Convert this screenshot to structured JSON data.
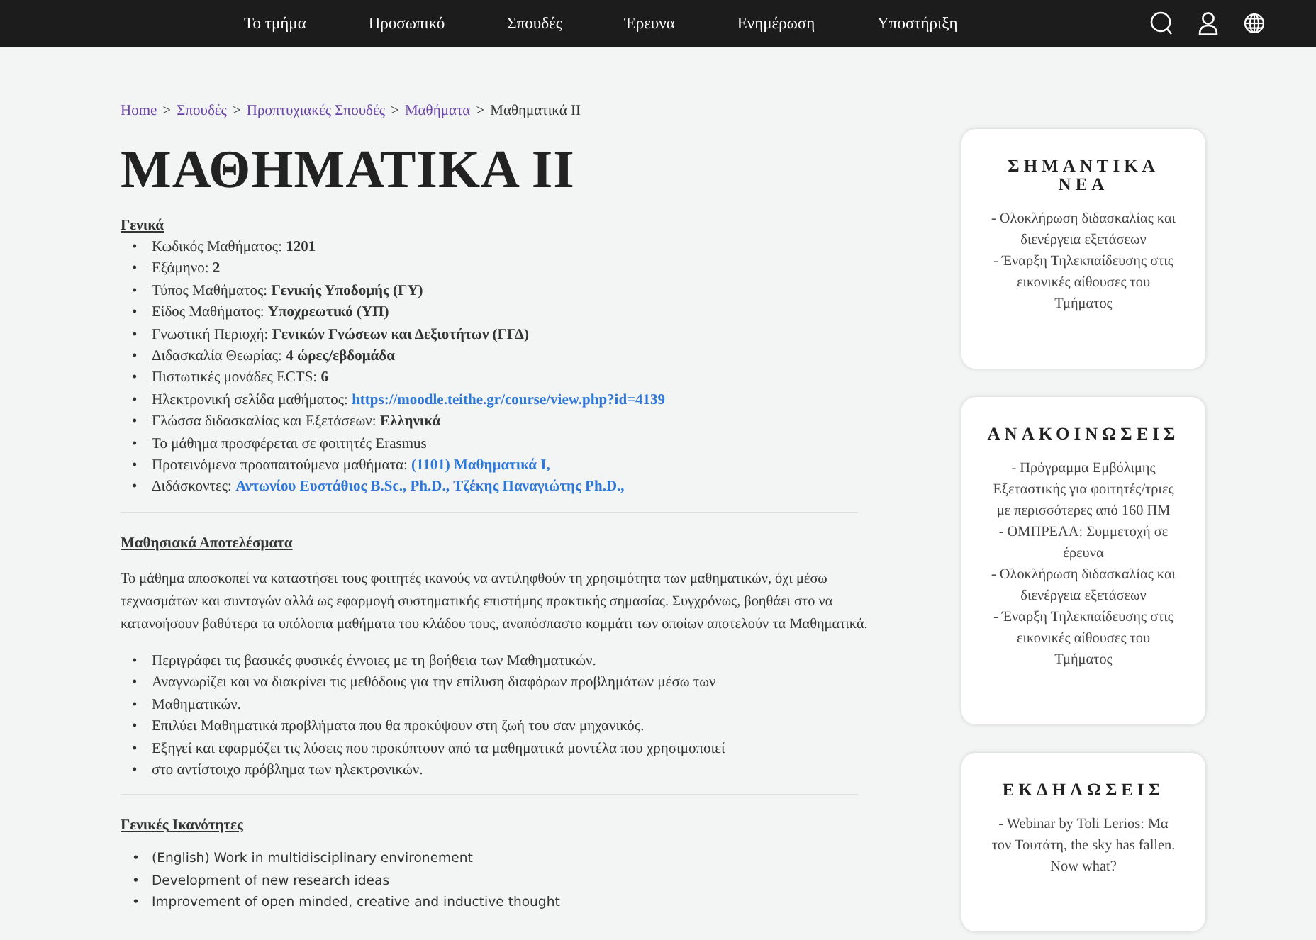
{
  "nav": {
    "items": [
      "Το τμήμα",
      "Προσωπικό",
      "Σπουδές",
      "Έρευνα",
      "Ενημέρωση",
      "Υποστήριξη"
    ]
  },
  "breadcrumb": [
    {
      "text": "Home",
      "link": true
    },
    {
      "text": "Σπουδές",
      "link": true
    },
    {
      "text": "Προπτυχιακές Σπουδές",
      "link": true
    },
    {
      "text": "Μαθήματα",
      "link": true
    },
    {
      "text": "Μαθηματικά II",
      "link": false
    }
  ],
  "breadcrumb_separator": ">",
  "bullet": "•",
  "title": "ΜΑΘΗΜΑΤΙΚΑ ΙΙ",
  "general": {
    "heading": "Γενικά",
    "items": [
      {
        "label": "Κωδικός Μαθήματος: ",
        "values": [
          {
            "text": "1201",
            "kind": "bold"
          }
        ]
      },
      {
        "label": "Εξάμηνο: ",
        "values": [
          {
            "text": "2",
            "kind": "bold"
          }
        ]
      },
      {
        "label": "Τύπος Μαθήματος: ",
        "values": [
          {
            "text": "Γενικής Υποδομής (ΓΥ)",
            "kind": "bold"
          }
        ]
      },
      {
        "label": "Είδος Μαθήματος: ",
        "values": [
          {
            "text": "Υποχρεωτικό (ΥΠ)",
            "kind": "bold"
          }
        ]
      },
      {
        "label": "Γνωστική Περιοχή: ",
        "values": [
          {
            "text": "Γενικών Γνώσεων και Δεξιοτήτων (ΓΓΔ)",
            "kind": "bold"
          }
        ]
      },
      {
        "label": "Διδασκαλία Θεωρίας: ",
        "values": [
          {
            "text": "4 ώρες/εβδομάδα",
            "kind": "bold"
          }
        ]
      },
      {
        "label": "Πιστωτικές μονάδες ECTS: ",
        "values": [
          {
            "text": "6",
            "kind": "bold"
          }
        ]
      },
      {
        "label": "Ηλεκτρονική σελίδα μαθήματος: ",
        "values": [
          {
            "text": "https://moodle.teithe.gr/course/view.php?id=4139",
            "kind": "link"
          }
        ]
      },
      {
        "label": "Γλώσσα διδασκαλίας και Εξετάσεων: ",
        "values": [
          {
            "text": "Ελληνικά",
            "kind": "bold"
          }
        ]
      },
      {
        "label": "Το μάθημα προσφέρεται σε φοιτητές Erasmus"
      },
      {
        "label": "Προτεινόμενα προαπαιτούμενα μαθήματα: ",
        "values": [
          {
            "text": "(1101) Μαθηματικά Ι,",
            "kind": "link"
          }
        ]
      },
      {
        "label": "Διδάσκοντες: ",
        "values": [
          {
            "text": "Αντωνίου Ευστάθιος B.Sc., Ph.D.,",
            "kind": "link"
          },
          {
            "text": "Τζέκης Παναγιώτης Ph.D.,",
            "kind": "link"
          }
        ]
      }
    ]
  },
  "outcomes": {
    "heading": "Μαθησιακά Αποτελέσματα",
    "paragraph": "Το μάθημα αποσκοπεί να καταστήσει τους φοιτητές ικανούς να αντιληφθούν τη χρησιμότητα των μαθηματικών, όχι μέσω τεχνασμάτων και συνταγών αλλά ως εφαρμογή συστηματικής επιστήμης πρακτικής σημασίας. Συγχρόνως, βοηθάει στο να κατανοήσουν βαθύτερα τα υπόλοιπα μαθήματα του κλάδου τους, αναπόσπαστο κομμάτι των οποίων αποτελούν τα Μαθηματικά.",
    "items": [
      "Περιγράφει τις βασικές φυσικές έννοιες με τη βοήθεια των Μαθηματικών.",
      "Αναγνωρίζει και να διακρίνει τις μεθόδους για την επίλυση διαφόρων προβλημάτων μέσω των",
      "Μαθηματικών.",
      "Επιλύει Μαθηματικά προβλήματα που θα προκύψουν στη ζωή του σαν μηχανικός.",
      "Εξηγεί και εφαρμόζει τις λύσεις που προκύπτουν από τα μαθηματικά μοντέλα που χρησιμοποιεί",
      "στο αντίστοιχο πρόβλημα των ηλεκτρονικών."
    ]
  },
  "competences": {
    "heading": "Γενικές Ικανότητες",
    "items": [
      "(English) Work in multidisciplinary environement",
      "Development of new research ideas",
      "Improvement of open minded, creative and inductive thought"
    ]
  },
  "sidebar": [
    {
      "title": "ΣΗΜΑΝΤΙΚΑ ΝΕΑ",
      "items": [
        "- Ολοκλήρωση διδασκαλίας και διενέργεια εξετάσεων",
        "- Έναρξη Τηλεκπαίδευσης στις εικονικές αίθουσες του Τμήματος"
      ]
    },
    {
      "title": "ΑΝΑΚΟΙΝΩΣΕΙΣ",
      "items": [
        "- Πρόγραμμα Εμβόλιμης Εξεταστικής για φοιτητές/τριες με περισσότερες από 160 ΠΜ",
        "- ΟΜΠΡΕΛΑ: Συμμετοχή σε έρευνα",
        "- Ολοκλήρωση διδασκαλίας και διενέργεια εξετάσεων",
        "- Έναρξη Τηλεκπαίδευσης στις εικονικές αίθουσες του Τμήματος"
      ]
    },
    {
      "title": "ΕΚΔΗΛΩΣΕΙΣ",
      "items": [
        "- Webinar by Toli Lerios: Μα τον Τουτάτη, the sky has fallen. Now what?"
      ]
    }
  ]
}
